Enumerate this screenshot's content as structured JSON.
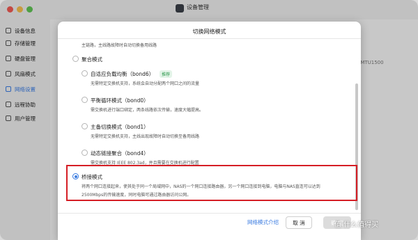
{
  "window": {
    "title": "设备管理"
  },
  "sidebar": {
    "items": [
      {
        "label": "设备信息",
        "icon": "info-icon",
        "active": false
      },
      {
        "label": "存储管理",
        "icon": "storage-icon",
        "active": false
      },
      {
        "label": "硬盘管理",
        "icon": "disk-icon",
        "active": false
      },
      {
        "label": "风扇模式",
        "icon": "fan-icon",
        "active": false
      },
      {
        "label": "网络设置",
        "icon": "network-icon",
        "active": true
      },
      {
        "label": "远程协助",
        "icon": "remote-icon",
        "active": false
      },
      {
        "label": "用户管理",
        "icon": "user-icon",
        "active": false
      }
    ]
  },
  "background": {
    "partial_text": "C, MTU1500"
  },
  "dialog": {
    "title": "切换网络模式",
    "top_desc": "主链路，主线路故障时自动切换备用线路",
    "aggregation": {
      "label": "聚合模式",
      "options": [
        {
          "label": "自适应负载均衡（bond6）",
          "badge": "推荐",
          "desc": "无需特定交换机支持，系统会自动分配两个网口之间的流量"
        },
        {
          "label": "平衡循环模式（bond0）",
          "desc": "需交换机进行端口绑定，两条线路依次传输，速度大幅提高。"
        },
        {
          "label": "主备切换模式（bond1）",
          "desc": "无需特定交换机支持，主线出现故障时自动切换至备用线路"
        },
        {
          "label": "动态链接聚合（bond4）",
          "desc": "需交换机支持 IEEE 802.3ad，并且需要在交换机进行配置"
        }
      ]
    },
    "bridge": {
      "label": "桥接模式",
      "desc_line1": "将两个网口连接起来，使其处于同一个局域网中，NAS的一个网口连接路由器，另一个网口连接到电脑，电脑与NAS直连可以达到",
      "desc_line2": "2500Mbps的传输速度，同时电脑可通过路由器访问公网。"
    },
    "footer": {
      "link": "网络模式介绍",
      "cancel": "取 消",
      "ok": "确 定"
    }
  },
  "watermark": "值 什么值得买",
  "colors": {
    "accent": "#3a7be0",
    "highlight": "#d51e25",
    "badge": "#2f9a4f"
  }
}
